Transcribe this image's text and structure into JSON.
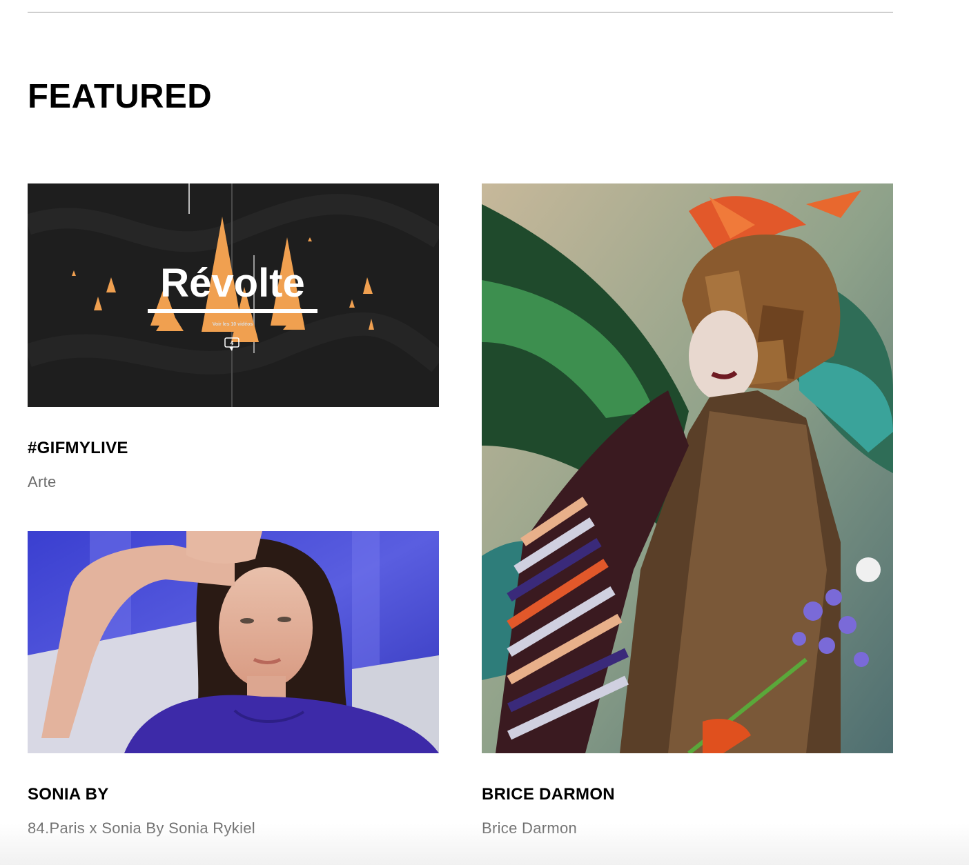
{
  "section": {
    "title": "FEATURED"
  },
  "cards": [
    {
      "title": "#GIFMYLIVE",
      "subtitle": "Arte",
      "thumb": {
        "headline": "Révolte",
        "caption": "Voir les 10 vidéos",
        "badge": "4",
        "background": "#1e1e1e",
        "accent": "#f0a050"
      }
    },
    {
      "title": "SONIA BY",
      "subtitle": "84.Paris x Sonia By Sonia Rykiel",
      "thumb": {
        "background": "#3a3fc0"
      }
    },
    {
      "title": "BRICE DARMON",
      "subtitle": "Brice Darmon",
      "thumb": {
        "background": "#6f8a6a"
      }
    }
  ]
}
